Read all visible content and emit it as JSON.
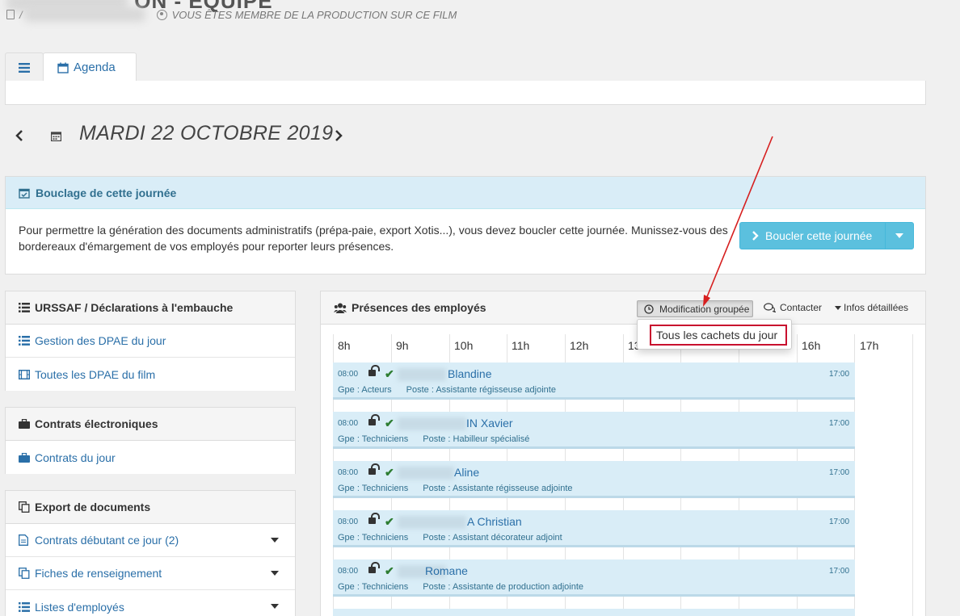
{
  "header": {
    "title": "ON - ÉQUIPE",
    "crumb_sep": "/",
    "member_note": "VOUS ÊTES MEMBRE DE LA PRODUCTION SUR CE FILM"
  },
  "tabs": [
    {
      "label": ""
    },
    {
      "label": "Agenda"
    }
  ],
  "date_nav": {
    "title": "MARDI 22 OCTOBRE 2019"
  },
  "bouclage": {
    "heading": "Bouclage de cette journée",
    "text": "Pour permettre la génération des documents administratifs (prépa-paie, export Xotis...), vous devez boucler cette journée. Munissez-vous des bordereaux d'émargement de vos employés pour reporter leurs présences.",
    "button": "Boucler cette journée"
  },
  "urssaf": {
    "heading": "URSSAF / Déclarations à l'embauche",
    "items": [
      "Gestion des DPAE du jour",
      "Toutes les DPAE du film"
    ]
  },
  "contrats": {
    "heading": "Contrats électroniques",
    "items": [
      "Contrats du jour"
    ]
  },
  "export": {
    "heading": "Export de documents",
    "items": [
      "Contrats débutant ce jour (2)",
      "Fiches de renseignement",
      "Listes d'employés"
    ]
  },
  "presences": {
    "heading": "Présences des employés",
    "modif_button": "Modification groupée",
    "contact": "Contacter",
    "infos": "Infos détaillées",
    "dropdown_item": "Tous les cachets du jour",
    "hours": [
      "8h",
      "9h",
      "10h",
      "11h",
      "12h",
      "13",
      "16h",
      "17h"
    ],
    "rows": [
      {
        "start": "08:00",
        "end": "17:00",
        "name": "A Blandine",
        "visible_name": "Blandine",
        "gpe": "Gpe : Acteurs",
        "poste": "Poste : Assistante régisseuse adjointe"
      },
      {
        "start": "08:00",
        "end": "17:00",
        "name": "IN Xavier",
        "visible_name": "IN Xavier",
        "gpe": "Gpe : Techniciens",
        "poste": "Poste : Habilleur spécialisé"
      },
      {
        "start": "08:00",
        "end": "17:00",
        "name": "B Aline",
        "visible_name": "Aline",
        "gpe": "Gpe : Techniciens",
        "poste": "Poste : Assistante régisseuse adjointe"
      },
      {
        "start": "08:00",
        "end": "17:00",
        "name": "E A Christian",
        "visible_name": "A Christian",
        "gpe": "Gpe : Techniciens",
        "poste": "Poste : Assistant décorateur adjoint"
      },
      {
        "start": "08:00",
        "end": "17:00",
        "name": "B Romane",
        "visible_name": "Romane",
        "gpe": "Gpe : Techniciens",
        "poste": "Poste : Assistante de production adjointe"
      }
    ]
  },
  "colors": {
    "link": "#2a6fa8",
    "info_bg": "#d9edf7",
    "info_btn": "#5bc0de",
    "annotation_red": "#c8102e"
  }
}
